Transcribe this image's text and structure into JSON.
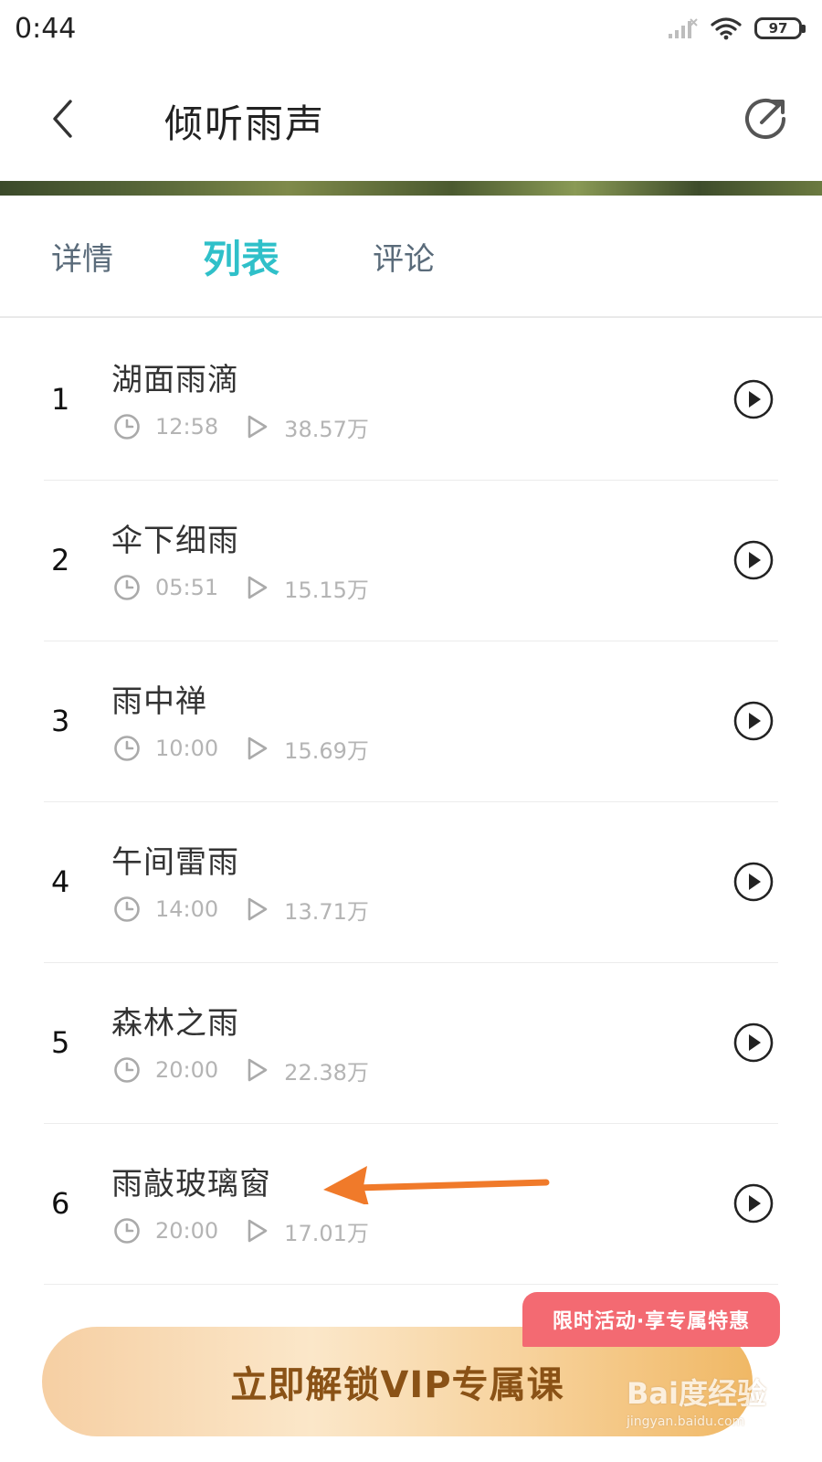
{
  "status_bar": {
    "time": "0:44",
    "battery": "97"
  },
  "header": {
    "title": "倾听雨声"
  },
  "tabs": [
    {
      "label": "详情",
      "active": false
    },
    {
      "label": "列表",
      "active": true
    },
    {
      "label": "评论",
      "active": false
    }
  ],
  "tracks": [
    {
      "index": "1",
      "title": "湖面雨滴",
      "duration": "12:58",
      "plays": "38.57万"
    },
    {
      "index": "2",
      "title": "伞下细雨",
      "duration": "05:51",
      "plays": "15.15万"
    },
    {
      "index": "3",
      "title": "雨中禅",
      "duration": "10:00",
      "plays": "15.69万"
    },
    {
      "index": "4",
      "title": "午间雷雨",
      "duration": "14:00",
      "plays": "13.71万"
    },
    {
      "index": "5",
      "title": "森林之雨",
      "duration": "20:00",
      "plays": "22.38万"
    },
    {
      "index": "6",
      "title": "雨敲玻璃窗",
      "duration": "20:00",
      "plays": "17.01万"
    }
  ],
  "promo": {
    "tag": "限时活动·享专属特惠",
    "button": "立即解锁VIP专属课"
  },
  "watermark": {
    "logo": "Bai度经验",
    "url": "jingyan.baidu.com"
  },
  "colors": {
    "accent": "#2fc0c9",
    "promo_tag": "#f36a72",
    "vip_text": "#8a5216",
    "annotation_arrow": "#f07a2a"
  }
}
